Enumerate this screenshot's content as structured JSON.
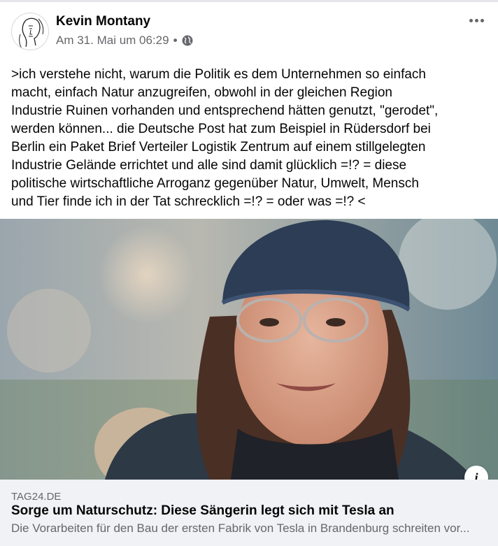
{
  "post": {
    "author": "Kevin Montany",
    "timestamp": "Am 31. Mai um 06:29",
    "separator": "•",
    "privacy_icon": "globe-icon",
    "more_icon": "more-options-icon",
    "text": ">ich verstehe nicht, warum die Politik es dem Unternehmen so einfach\nmacht, einfach Natur anzugreifen, obwohl in der gleichen Region\nIndustrie Ruinen vorhanden und entsprechend hätten  genutzt, \"gerodet\",\nwerden können... die Deutsche Post hat zum Beispiel in Rüdersdorf bei\nBerlin ein Paket Brief Verteiler Logistik Zentrum auf einem stillgelegten\nIndustrie Gelände errichtet und alle sind damit glücklich =!? = diese\npolitische wirtschaftliche Arroganz gegenüber Natur, Umwelt, Mensch\nund Tier finde ich in der Tat schrecklich =!? = oder was =!? <"
  },
  "link_preview": {
    "domain": "TAG24.DE",
    "headline": "Sorge um Naturschutz: Diese Sängerin legt sich mit Tesla an",
    "description": "Die Vorarbeiten für den Bau der ersten Fabrik von Tesla in Brandenburg schreiten vor...",
    "info_label": "i"
  },
  "colors": {
    "text_primary": "#050505",
    "text_secondary": "#65676b",
    "link_background": "#f0f2f5"
  }
}
